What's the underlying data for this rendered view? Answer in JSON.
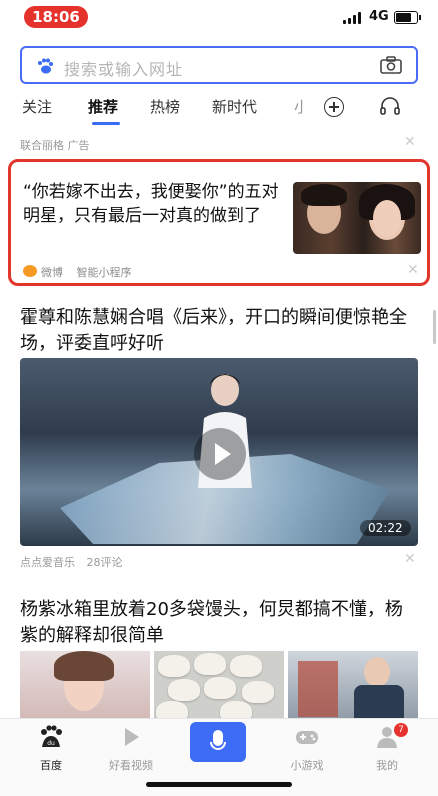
{
  "status_bar": {
    "time": "18:06",
    "network": "4G"
  },
  "search": {
    "placeholder": "搜索或输入网址"
  },
  "tabs": [
    {
      "label": "关注"
    },
    {
      "label": "推荐"
    },
    {
      "label": "热榜"
    },
    {
      "label": "新时代"
    },
    {
      "label": "小"
    }
  ],
  "ad_label": "联合丽格  广告",
  "highlight_card": {
    "title": "“你若嫁不出去，我便娶你”的五对明星，只有最后一对真的做到了",
    "source": "微博",
    "tag": "智能小程序"
  },
  "article2": {
    "title": "霍尊和陈慧娴合唱《后来》，开口的瞬间便惊艳全场，评委直呼好听",
    "duration": "02:22",
    "source": "点点爱音乐",
    "comments": "28评论"
  },
  "article3": {
    "title": "杨紫冰箱里放着20多袋馒头，何炅都搞不懂，杨紫的解释却很简单"
  },
  "bottom_nav": {
    "items": [
      {
        "label": "百度"
      },
      {
        "label": "好看视频"
      },
      {
        "label": "小游戏"
      },
      {
        "label": "我的"
      }
    ],
    "badge": "7"
  },
  "colors": {
    "accent": "#3d6cf6",
    "highlight_border": "#e2352c",
    "time_pill": "#e5322d"
  }
}
